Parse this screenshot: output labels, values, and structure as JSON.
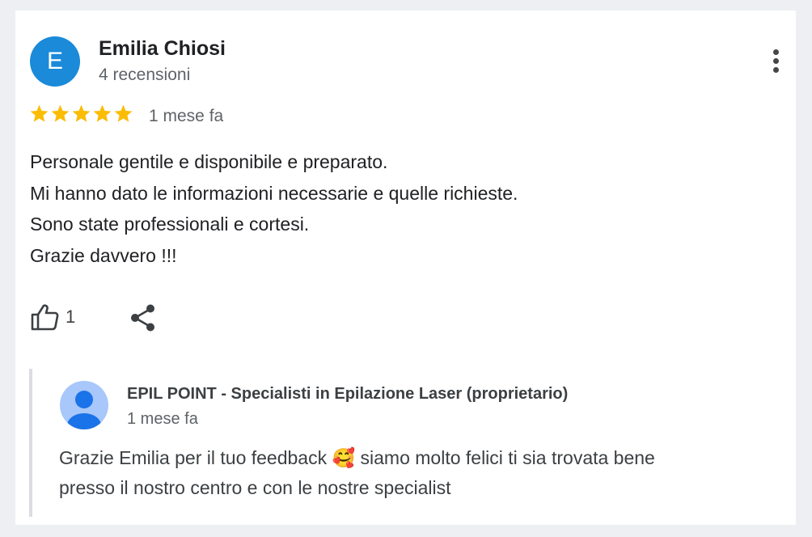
{
  "review": {
    "reviewer_initial": "E",
    "reviewer_name": "Emilia Chiosi",
    "review_count": "4 recensioni",
    "rating": 5,
    "rating_max": 5,
    "date": "1 mese fa",
    "text_lines": [
      "Personale gentile e disponibile e preparato.",
      "Mi hanno dato le informazioni necessarie e quelle richieste.",
      "Sono state professionali e cortesi.",
      "Grazie davvero !!!"
    ],
    "like_count": "1"
  },
  "reply": {
    "owner_name": "EPIL POINT - Specialisti in Epilazione Laser (proprietario)",
    "date": "1 mese fa",
    "text_lines": [
      "Grazie Emilia per il tuo feedback 🥰 siamo molto felici ti sia trovata bene",
      "presso il nostro centro e con le nostre specialist"
    ]
  },
  "colors": {
    "page_background": "#eeeff3",
    "avatar_blue": "#1a8ad9",
    "star_gold": "#fbbc04",
    "owner_avatar_bg": "#a8c7fa",
    "owner_avatar_figure": "#1a73e8"
  },
  "icons": {
    "more": "more-vert-icon",
    "like": "thumb-up-outline-icon",
    "share": "share-icon",
    "star": "star-icon"
  }
}
